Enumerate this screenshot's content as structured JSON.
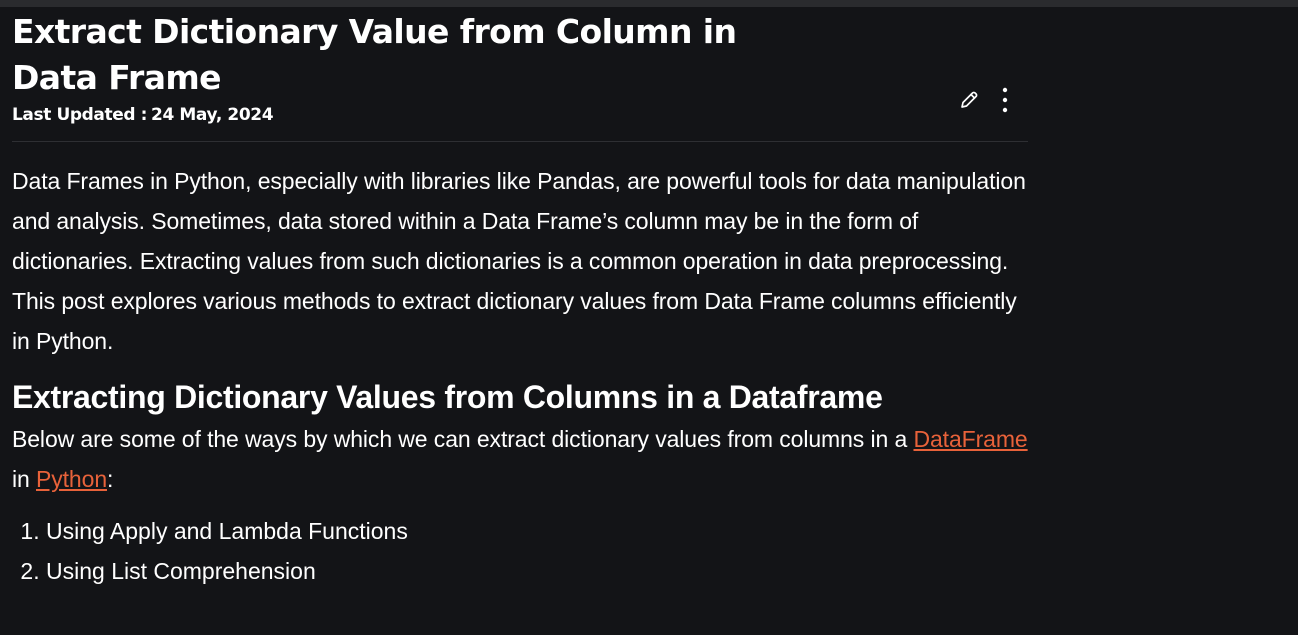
{
  "article": {
    "title": "Extract Dictionary Value from Column in Data Frame",
    "last_updated_label": "Last Updated :",
    "last_updated_value": "24 May, 2024",
    "intro": "Data Frames in Python, especially with libraries like Pandas, are powerful tools for data manipulation and analysis. Sometimes, data stored within a Data Frame’s column may be in the form of dictionaries. Extracting values from such dictionaries is a common operation in data preprocessing. This post explores various methods to extract dictionary values from Data Frame columns efficiently in Python.",
    "section_heading": "Extracting Dictionary Values from Columns in a Dataframe",
    "section_text_before": "Below are some of the ways by which we can extract dictionary values from columns in a ",
    "link_dataframe": "DataFrame ",
    "section_text_middle": "in ",
    "link_python": "Python",
    "section_text_after": ":",
    "methods": [
      "Using Apply and Lambda Functions",
      "Using List Comprehension"
    ]
  },
  "icons": {
    "edit": "pencil-icon",
    "more": "more-vertical-icon"
  },
  "colors": {
    "background": "#131417",
    "text": "#ffffff",
    "link": "#e8623a",
    "divider": "#2e2f33"
  }
}
